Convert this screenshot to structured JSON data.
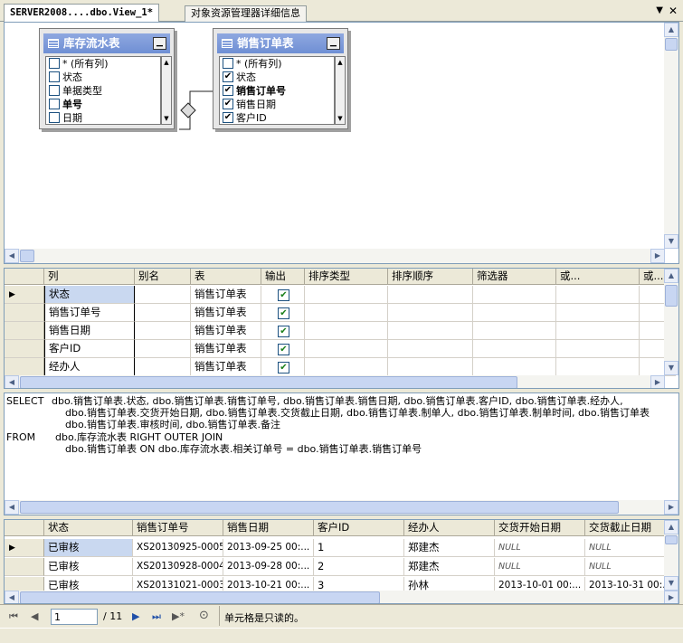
{
  "tabs": [
    {
      "label": "SERVER2008....dbo.View_1*"
    },
    {
      "label": "对象资源管理器详细信息"
    }
  ],
  "tab_menu_icon": "dropdown-arrow",
  "tab_close_icon": "close-x",
  "diagram": {
    "tables": [
      {
        "title": "库存流水表",
        "rows": [
          {
            "label": "* (所有列)",
            "checked": false,
            "bold": false
          },
          {
            "label": "状态",
            "checked": false,
            "bold": false
          },
          {
            "label": "单据类型",
            "checked": false,
            "bold": false
          },
          {
            "label": "单号",
            "checked": false,
            "bold": true
          },
          {
            "label": "日期",
            "checked": false,
            "bold": false
          }
        ]
      },
      {
        "title": "销售订单表",
        "rows": [
          {
            "label": "* (所有列)",
            "checked": false,
            "bold": false
          },
          {
            "label": "状态",
            "checked": true,
            "bold": false
          },
          {
            "label": "销售订单号",
            "checked": true,
            "bold": true
          },
          {
            "label": "销售日期",
            "checked": true,
            "bold": false
          },
          {
            "label": "客户ID",
            "checked": true,
            "bold": false
          }
        ]
      }
    ]
  },
  "criteria": {
    "headers": [
      "列",
      "别名",
      "表",
      "输出",
      "排序类型",
      "排序顺序",
      "筛选器",
      "或...",
      "或..."
    ],
    "rows": [
      {
        "col": "状态",
        "alias": "",
        "table": "销售订单表",
        "output": true
      },
      {
        "col": "销售订单号",
        "alias": "",
        "table": "销售订单表",
        "output": true
      },
      {
        "col": "销售日期",
        "alias": "",
        "table": "销售订单表",
        "output": true
      },
      {
        "col": "客户ID",
        "alias": "",
        "table": "销售订单表",
        "output": true
      },
      {
        "col": "经办人",
        "alias": "",
        "table": "销售订单表",
        "output": true
      }
    ]
  },
  "sql": {
    "select_kw": "SELECT",
    "select_lines": [
      "dbo.销售订单表.状态, dbo.销售订单表.销售订单号, dbo.销售订单表.销售日期, dbo.销售订单表.客户ID, dbo.销售订单表.经办人,",
      "dbo.销售订单表.交货开始日期, dbo.销售订单表.交货截止日期, dbo.销售订单表.制单人, dbo.销售订单表.制单时间, dbo.销售订单表",
      "dbo.销售订单表.审核时间, dbo.销售订单表.备注"
    ],
    "from_kw": "FROM",
    "from_lines": [
      "dbo.库存流水表 RIGHT OUTER JOIN",
      "dbo.销售订单表 ON dbo.库存流水表.相关订单号 = dbo.销售订单表.销售订单号"
    ]
  },
  "results": {
    "headers": [
      "状态",
      "销售订单号",
      "销售日期",
      "客户ID",
      "经办人",
      "交货开始日期",
      "交货截止日期"
    ],
    "rows": [
      [
        "已审核",
        "XS20130925-0005",
        "2013-09-25 00:...",
        "1",
        "郑建杰",
        "NULL",
        "NULL"
      ],
      [
        "已审核",
        "XS20130928-0004",
        "2013-09-28 00:...",
        "2",
        "郑建杰",
        "NULL",
        "NULL"
      ],
      [
        "已审核",
        "XS20131021-0003",
        "2013-10-21 00:...",
        "3",
        "孙林",
        "2013-10-01 00:...",
        "2013-10-31 00:..."
      ]
    ]
  },
  "navbar": {
    "page_value": "1",
    "page_total": "/ 11",
    "status": "单元格是只读的。"
  }
}
